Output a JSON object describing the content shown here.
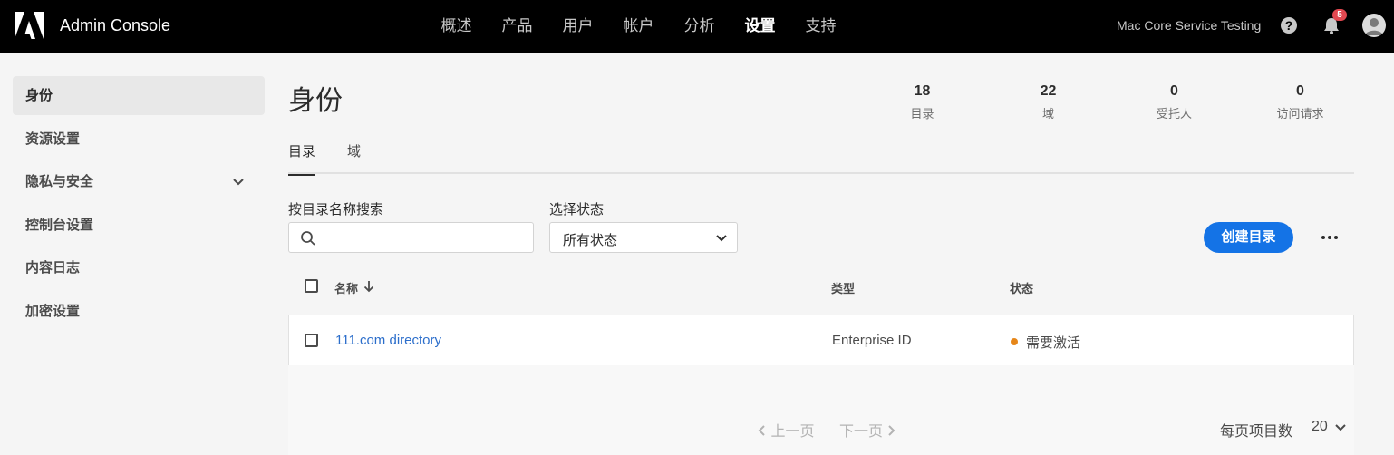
{
  "header": {
    "app_title": "Admin Console",
    "nav": [
      {
        "label": "概述",
        "active": false
      },
      {
        "label": "产品",
        "active": false
      },
      {
        "label": "用户",
        "active": false
      },
      {
        "label": "帐户",
        "active": false
      },
      {
        "label": "分析",
        "active": false
      },
      {
        "label": "设置",
        "active": true
      },
      {
        "label": "支持",
        "active": false
      }
    ],
    "org_name": "Mac Core Service Testing",
    "notification_count": "5",
    "icons": [
      "adobe-logo-icon",
      "help-icon",
      "bell-icon",
      "avatar"
    ]
  },
  "sidebar": {
    "items": [
      {
        "label": "身份",
        "active": true
      },
      {
        "label": "资源设置",
        "active": false
      },
      {
        "label": "隐私与安全",
        "active": false,
        "expandable": true
      },
      {
        "label": "控制台设置",
        "active": false
      },
      {
        "label": "内容日志",
        "active": false
      },
      {
        "label": "加密设置",
        "active": false
      }
    ]
  },
  "main": {
    "title": "身份",
    "stats": [
      {
        "value": "18",
        "label": "目录"
      },
      {
        "value": "22",
        "label": "域"
      },
      {
        "value": "0",
        "label": "受托人"
      },
      {
        "value": "0",
        "label": "访问请求"
      }
    ],
    "tabs": [
      {
        "label": "目录",
        "active": true
      },
      {
        "label": "域",
        "active": false
      }
    ],
    "search_label": "按目录名称搜索",
    "search_value": "",
    "search_placeholder": "",
    "status_label": "选择状态",
    "status_value": "所有状态",
    "create_button": "创建目录",
    "table": {
      "columns": [
        "名称",
        "类型",
        "状态"
      ],
      "rows": [
        {
          "name": "111.com directory",
          "type": "Enterprise ID",
          "status": "需要激活",
          "status_color": "#e68619"
        }
      ]
    },
    "pagination": {
      "prev": "上一页",
      "next": "下一页",
      "per_page_label": "每页项目数",
      "per_page_value": "20"
    }
  },
  "colors": {
    "accent": "#1473e6",
    "link": "#2c6ecb",
    "topbar": "#000000",
    "badge": "#e34850"
  }
}
